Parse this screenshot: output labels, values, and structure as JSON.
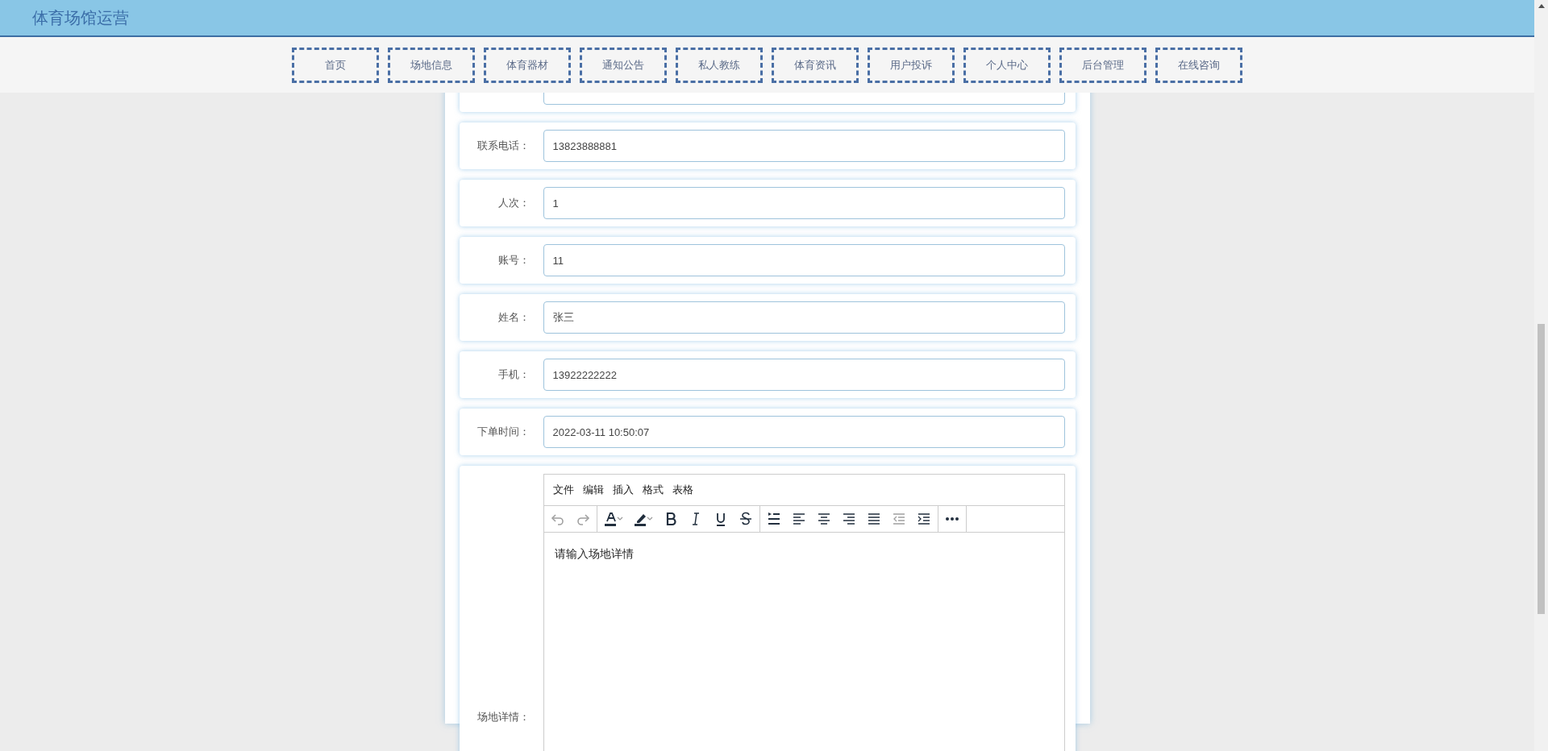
{
  "header": {
    "title": "体育场馆运营"
  },
  "nav": [
    {
      "label": "首页"
    },
    {
      "label": "场地信息"
    },
    {
      "label": "体育器材"
    },
    {
      "label": "通知公告"
    },
    {
      "label": "私人教练"
    },
    {
      "label": "体育资讯"
    },
    {
      "label": "用户投诉"
    },
    {
      "label": "个人中心"
    },
    {
      "label": "后台管理"
    },
    {
      "label": "在线咨询"
    }
  ],
  "form": {
    "fields": [
      {
        "label": "联系电话：",
        "value": "13823888881"
      },
      {
        "label": "人次：",
        "value": "1"
      },
      {
        "label": "账号：",
        "value": "11"
      },
      {
        "label": "姓名：",
        "value": "张三"
      },
      {
        "label": "手机：",
        "value": "13922222222"
      },
      {
        "label": "下单时间：",
        "value": "2022-03-11 10:50:07"
      }
    ],
    "editor": {
      "label": "场地详情：",
      "menu": [
        "文件",
        "编辑",
        "插入",
        "格式",
        "表格"
      ],
      "toolbar_groups": [
        [
          {
            "disabled": true
          },
          {
            "disabled": true
          }
        ],
        [
          {
            "disabled": false
          },
          {
            "disabled": false
          },
          {
            "disabled": false
          },
          {
            "disabled": false
          },
          {
            "disabled": false
          },
          {
            "disabled": false
          }
        ],
        [
          {
            "disabled": false
          },
          {
            "disabled": false
          },
          {
            "disabled": false
          },
          {
            "disabled": false
          },
          {
            "disabled": false
          },
          {
            "disabled": true
          },
          {
            "disabled": false
          }
        ],
        [
          {
            "disabled": false
          }
        ]
      ],
      "content": "请输入场地详情"
    }
  }
}
